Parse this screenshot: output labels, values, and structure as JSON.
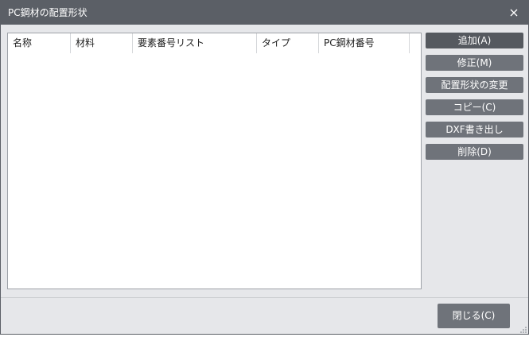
{
  "window": {
    "title": "PC鋼材の配置形状"
  },
  "table": {
    "columns": [
      "名称",
      "材料",
      "要素番号リスト",
      "タイプ",
      "PC鋼材番号"
    ],
    "rows": []
  },
  "actions": {
    "add": "追加(A)",
    "edit": "修正(M)",
    "change_shape": "配置形状の変更",
    "copy": "コピー(C)",
    "dxf_export": "DXF書き出し",
    "delete": "削除(D)"
  },
  "footer": {
    "close": "閉じる(C)"
  },
  "colors": {
    "titlebar": "#5b5f66",
    "button": "#6f737a",
    "button_primary": "#55595f",
    "dialog_bg": "#e6e7ea"
  },
  "icons": {
    "close": "close-icon",
    "resize": "resize-grip-icon"
  }
}
